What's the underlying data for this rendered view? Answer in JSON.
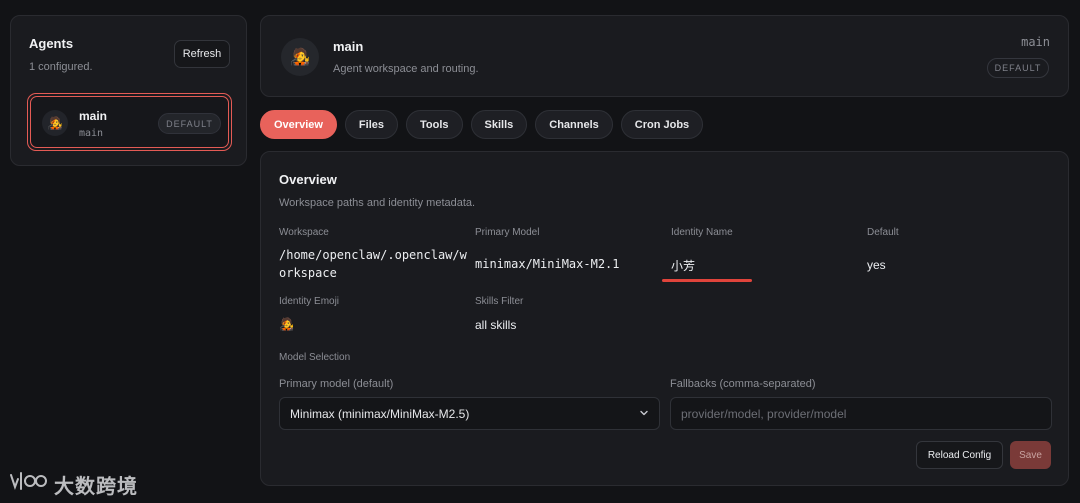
{
  "agents_panel": {
    "title": "Agents",
    "subtitle": "1 configured.",
    "refresh_label": "Refresh",
    "items": [
      {
        "emoji": "🧑‍🎤",
        "name": "main",
        "id": "main",
        "badge": "DEFAULT"
      }
    ]
  },
  "header": {
    "emoji": "🧑‍🎤",
    "name": "main",
    "subtitle": "Agent workspace and routing.",
    "id": "main",
    "badge": "DEFAULT"
  },
  "tabs": [
    {
      "label": "Overview",
      "active": true
    },
    {
      "label": "Files",
      "active": false
    },
    {
      "label": "Tools",
      "active": false
    },
    {
      "label": "Skills",
      "active": false
    },
    {
      "label": "Channels",
      "active": false
    },
    {
      "label": "Cron Jobs",
      "active": false
    }
  ],
  "overview": {
    "title": "Overview",
    "subtitle": "Workspace paths and identity metadata.",
    "fields": {
      "workspace_label": "Workspace",
      "workspace_value_line1": "/home/openclaw/.openclaw/w",
      "workspace_value_line2": "orkspace",
      "primary_model_label": "Primary Model",
      "primary_model_value": "minimax/MiniMax-M2.1",
      "identity_name_label": "Identity Name",
      "identity_name_value": "小芳",
      "default_label": "Default",
      "default_value": "yes",
      "identity_emoji_label": "Identity Emoji",
      "identity_emoji_value": "🧑‍🎤",
      "skills_filter_label": "Skills Filter",
      "skills_filter_value": "all skills"
    },
    "model_selection": {
      "section_label": "Model Selection",
      "primary_label": "Primary model (default)",
      "primary_selected": "Minimax (minimax/MiniMax-M2.5)",
      "fallbacks_label": "Fallbacks (comma-separated)",
      "fallbacks_placeholder": "provider/model, provider/model"
    },
    "reload_label": "Reload Config",
    "save_label": "Save"
  },
  "watermark": {
    "text": "大数跨境"
  },
  "colors": {
    "accent": "#e8625b",
    "background": "#121316",
    "panel": "#1a1b1f",
    "highlight": "#e0443b"
  }
}
